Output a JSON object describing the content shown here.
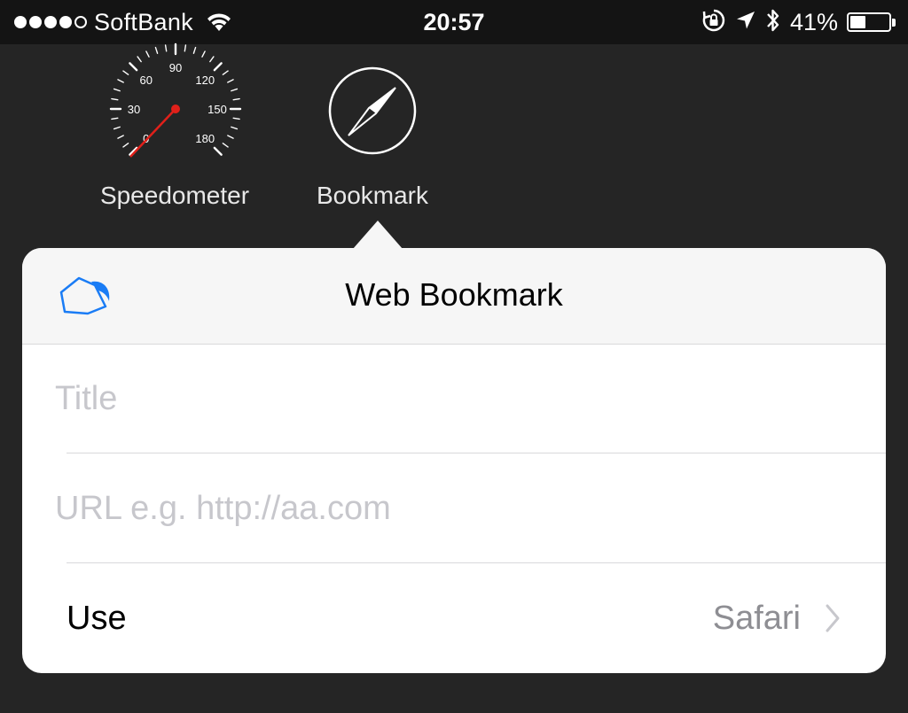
{
  "status_bar": {
    "carrier": "SoftBank",
    "time": "20:57",
    "battery_percent": "41%",
    "battery_level": 0.41,
    "signal_strength": 4,
    "signal_max": 5
  },
  "apps": [
    {
      "label": "Speedometer",
      "icon": "speedometer-icon",
      "dial_labels": [
        "0",
        "30",
        "60",
        "90",
        "120",
        "150",
        "180"
      ]
    },
    {
      "label": "Bookmark",
      "icon": "compass-icon"
    }
  ],
  "popover": {
    "title": "Web Bookmark",
    "header_icon": "bookmark-tag-icon",
    "title_field": {
      "placeholder": "Title",
      "value": ""
    },
    "url_field": {
      "placeholder": "URL e.g. http://aa.com",
      "value": ""
    },
    "use_row": {
      "label": "Use",
      "value": "Safari",
      "chevron_icon": "chevron-right-icon"
    }
  },
  "colors": {
    "background": "#252525",
    "status_bar_bg": "#141414",
    "accent_blue": "#1a7cf5",
    "needle_red": "#e0201a",
    "placeholder": "#c7c7cc",
    "secondary_text": "#8e8e93"
  }
}
